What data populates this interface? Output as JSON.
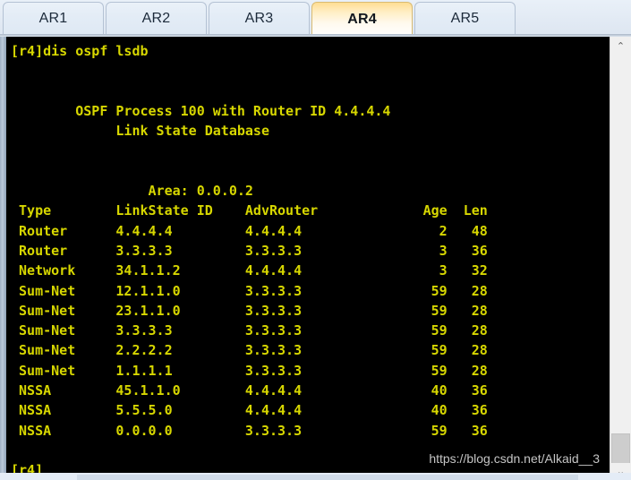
{
  "window": {
    "tabs": [
      {
        "label": "AR1",
        "active": false
      },
      {
        "label": "AR2",
        "active": false
      },
      {
        "label": "AR3",
        "active": false
      },
      {
        "label": "AR4",
        "active": true
      },
      {
        "label": "AR5",
        "active": false
      }
    ]
  },
  "terminal": {
    "prompt": "[r4]",
    "command": "dis ospf lsdb",
    "command_line": "[r4]dis ospf lsdb",
    "process_header": "OSPF Process 100 with Router ID 4.4.4.4",
    "database_title": "Link State Database",
    "area_label": "Area:",
    "area_value": "0.0.0.2",
    "columns": [
      "Type",
      "LinkState ID",
      "AdvRouter",
      "Age",
      "Len"
    ],
    "rows": [
      {
        "type": "Router",
        "linkstate_id": "4.4.4.4",
        "adv_router": "4.4.4.4",
        "age": "2",
        "len": "48"
      },
      {
        "type": "Router",
        "linkstate_id": "3.3.3.3",
        "adv_router": "3.3.3.3",
        "age": "3",
        "len": "36"
      },
      {
        "type": "Network",
        "linkstate_id": "34.1.1.2",
        "adv_router": "4.4.4.4",
        "age": "3",
        "len": "32"
      },
      {
        "type": "Sum-Net",
        "linkstate_id": "12.1.1.0",
        "adv_router": "3.3.3.3",
        "age": "59",
        "len": "28"
      },
      {
        "type": "Sum-Net",
        "linkstate_id": "23.1.1.0",
        "adv_router": "3.3.3.3",
        "age": "59",
        "len": "28"
      },
      {
        "type": "Sum-Net",
        "linkstate_id": "3.3.3.3",
        "adv_router": "3.3.3.3",
        "age": "59",
        "len": "28"
      },
      {
        "type": "Sum-Net",
        "linkstate_id": "2.2.2.2",
        "adv_router": "3.3.3.3",
        "age": "59",
        "len": "28"
      },
      {
        "type": "Sum-Net",
        "linkstate_id": "1.1.1.1",
        "adv_router": "3.3.3.3",
        "age": "59",
        "len": "28"
      },
      {
        "type": "NSSA",
        "linkstate_id": "45.1.1.0",
        "adv_router": "4.4.4.4",
        "age": "40",
        "len": "36"
      },
      {
        "type": "NSSA",
        "linkstate_id": "5.5.5.0",
        "adv_router": "4.4.4.4",
        "age": "40",
        "len": "36"
      },
      {
        "type": "NSSA",
        "linkstate_id": "0.0.0.0",
        "adv_router": "3.3.3.3",
        "age": "59",
        "len": "36"
      }
    ],
    "trailing_prompt": "[r4]",
    "text_color": "#d7d700",
    "background_color": "#000000",
    "screen_text": "[r4]dis ospf lsdb\n\n\n        OSPF Process 100 with Router ID 4.4.4.4\n             Link State Database\n\n\n                 Area: 0.0.0.2\n Type        LinkState ID    AdvRouter             Age  Len\n Router      4.4.4.4         4.4.4.4                 2   48\n Router      3.3.3.3         3.3.3.3                 3   36\n Network     34.1.1.2        4.4.4.4                 3   32\n Sum-Net     12.1.1.0        3.3.3.3                59   28\n Sum-Net     23.1.1.0        3.3.3.3                59   28\n Sum-Net     3.3.3.3         3.3.3.3                59   28\n Sum-Net     2.2.2.2         3.3.3.3                59   28\n Sum-Net     1.1.1.1         3.3.3.3                59   28\n NSSA        45.1.1.0        4.4.4.4                40   36\n NSSA        5.5.5.0         4.4.4.4                40   36\n NSSA        0.0.0.0         3.3.3.3                59   36\n\n[r4]"
  },
  "watermark": {
    "text": "https://blog.csdn.net/Alkaid__3"
  },
  "scrollbar": {
    "up_arrow": "⌃",
    "down_arrow": "⌄"
  }
}
